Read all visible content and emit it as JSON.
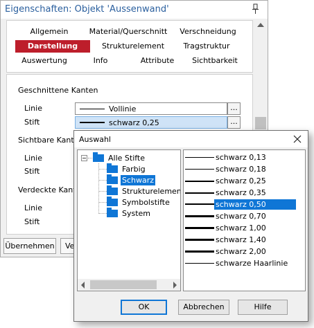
{
  "properties": {
    "title": "Eigenschaften: Objekt 'Aussenwand'",
    "tabs": [
      {
        "label": "Allgemein",
        "active": false
      },
      {
        "label": "Material/Querschnitt",
        "active": false
      },
      {
        "label": "Verschneidung",
        "active": false
      },
      {
        "label": "Darstellung",
        "active": true
      },
      {
        "label": "Strukturelement",
        "active": false
      },
      {
        "label": "Tragstruktur",
        "active": false
      },
      {
        "label": "Auswertung",
        "active": false
      },
      {
        "label": "Info",
        "active": false
      },
      {
        "label": "Attribute",
        "active": false
      },
      {
        "label": "Sichtbarkeit",
        "active": false
      }
    ],
    "sections": [
      {
        "heading": "Geschnittene Kanten",
        "rows": [
          {
            "label": "Linie",
            "value": "Vollinie",
            "dots": "...",
            "selected": false
          },
          {
            "label": "Stift",
            "value": "schwarz 0,25",
            "dots": "...",
            "selected": true
          }
        ]
      },
      {
        "heading": "Sichtbare Kanten",
        "rows": [
          {
            "label": "Linie"
          },
          {
            "label": "Stift"
          }
        ]
      },
      {
        "heading": "Verdeckte Kanten",
        "rows": [
          {
            "label": "Linie"
          },
          {
            "label": "Stift"
          }
        ]
      }
    ],
    "buttons": {
      "apply": "Übernehmen",
      "second": "Ve"
    }
  },
  "dialog": {
    "title": "Auswahl",
    "tree": {
      "root": "Alle Stifte",
      "children": [
        "Farbig",
        "Schwarz",
        "Strukturelemente",
        "Symbolstifte",
        "System"
      ],
      "selected": "Schwarz"
    },
    "pens": [
      "schwarz 0,13",
      "schwarz 0,18",
      "schwarz 0,25",
      "schwarz 0,35",
      "schwarz 0,50",
      "schwarz 0,70",
      "schwarz 1,00",
      "schwarz 1,40",
      "schwarz 2,00",
      "schwarze Haarlinie"
    ],
    "selected_pen": "schwarz 0,50",
    "buttons": {
      "ok": "OK",
      "cancel": "Abbrechen",
      "help": "Hilfe"
    }
  },
  "colors": {
    "accent": "#bd1e2b",
    "selection": "#0f76d6",
    "field_highlight": "#cfe3f7",
    "title_text": "#2a5f9e"
  },
  "icons": {
    "pin": "pin-icon",
    "close": "close-icon",
    "folder": "folder-icon"
  }
}
